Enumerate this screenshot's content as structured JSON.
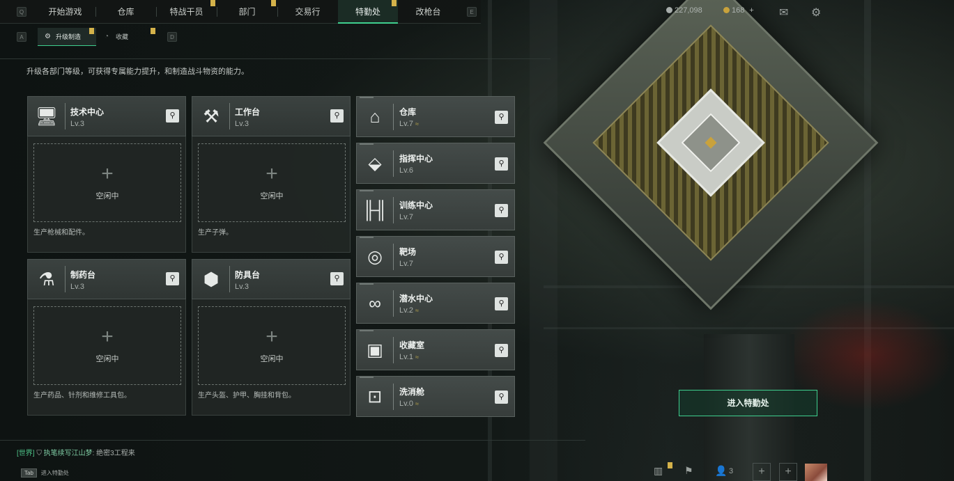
{
  "nav": {
    "tabs": [
      {
        "label": "开始游戏",
        "badge": false
      },
      {
        "label": "仓库",
        "badge": false
      },
      {
        "label": "特战干员",
        "badge": true
      },
      {
        "label": "部门",
        "badge": true
      },
      {
        "label": "交易行",
        "badge": false
      },
      {
        "label": "特勤处",
        "badge": true,
        "active": true
      },
      {
        "label": "改枪台",
        "badge": false
      }
    ],
    "key_left": "Q",
    "key_right": "E"
  },
  "subnav": {
    "tabs": [
      {
        "label": "升级制造",
        "active": true
      },
      {
        "label": "收藏",
        "active": false
      }
    ],
    "key_left": "A",
    "key_right": "D"
  },
  "description": "升级各部门等级，可获得专属能力提升，和制造战斗物资的能力。",
  "resources": {
    "silver": "227,098",
    "gold": "168",
    "gold_add": "+"
  },
  "workstations": [
    {
      "name": "技术中心",
      "level": "Lv.3",
      "icon": "monitor-icon",
      "glyph": "🖥",
      "slot_plus": "+",
      "slot_status": "空闲中",
      "desc": "生产枪械和配件。"
    },
    {
      "name": "工作台",
      "level": "Lv.3",
      "icon": "tools-icon",
      "glyph": "⚒",
      "slot_plus": "+",
      "slot_status": "空闲中",
      "desc": "生产子弹。"
    },
    {
      "name": "制药台",
      "level": "Lv.3",
      "icon": "microscope-icon",
      "glyph": "⚗",
      "slot_plus": "+",
      "slot_status": "空闲中",
      "desc": "生产药品、针剂和维修工具包。"
    },
    {
      "name": "防具台",
      "level": "Lv.3",
      "icon": "cubes-icon",
      "glyph": "⬢",
      "slot_plus": "+",
      "slot_status": "空闲中",
      "desc": "生产头盔、护甲、胸挂和背包。"
    }
  ],
  "rooms": [
    {
      "name": "仓库",
      "level": "Lv.7",
      "upgrade": "≈",
      "icon": "warehouse-icon",
      "glyph": "⌂"
    },
    {
      "name": "指挥中心",
      "level": "Lv.6",
      "upgrade": "",
      "icon": "chip-icon",
      "glyph": "⬙"
    },
    {
      "name": "训练中心",
      "level": "Lv.7",
      "upgrade": "",
      "icon": "dumbbell-icon",
      "glyph": "╟╢"
    },
    {
      "name": "靶场",
      "level": "Lv.7",
      "upgrade": "",
      "icon": "target-icon",
      "glyph": "◎"
    },
    {
      "name": "潜水中心",
      "level": "Lv.2",
      "upgrade": "≈",
      "icon": "diving-mask-icon",
      "glyph": "∞"
    },
    {
      "name": "收藏室",
      "level": "Lv.1",
      "upgrade": "≈",
      "icon": "collection-icon",
      "glyph": "▣"
    },
    {
      "name": "洗消舱",
      "level": "Lv.0",
      "upgrade": "≈",
      "icon": "decon-pod-icon",
      "glyph": "⊡"
    }
  ],
  "search_glyph": "⚲",
  "enter_button": "进入特勤处",
  "chat": {
    "channel": "[世界]",
    "name": "执笔续写江山梦",
    "message": ": 绝密3工程来"
  },
  "tab_hint": {
    "key": "Tab",
    "label": "进入特勤处"
  },
  "bottom": {
    "friends_count": "3",
    "plus": "+"
  },
  "colors": {
    "accent": "#3fd08f",
    "badge": "#d4b24a",
    "upgrade": "#b4a04a"
  }
}
